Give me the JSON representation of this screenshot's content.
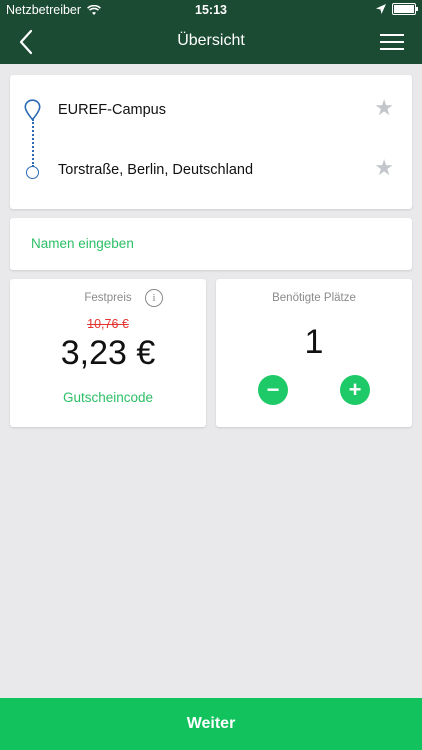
{
  "status_bar": {
    "carrier": "Netzbetreiber",
    "time": "15:13"
  },
  "nav": {
    "title": "Übersicht"
  },
  "route": {
    "from": "EUREF-Campus",
    "to": "Torstraße, Berlin, Deutschland"
  },
  "passenger": {
    "name_placeholder": "Namen eingeben"
  },
  "price": {
    "label": "Festpreis",
    "old_price": "10,76 €",
    "current_price": "3,23 €",
    "voucher_label": "Gutscheincode"
  },
  "seats": {
    "label": "Benötigte Plätze",
    "count": "1",
    "minus_symbol": "−",
    "plus_symbol": "+"
  },
  "footer": {
    "continue_label": "Weiter"
  },
  "colors": {
    "header_bg": "#1b4b33",
    "accent_green": "#12c35d",
    "strike_red": "#e3342f",
    "route_blue": "#2a6ab3"
  },
  "icons": [
    "wifi-icon",
    "location-arrow-icon",
    "battery-icon",
    "back-chevron-icon",
    "menu-icon",
    "pin-icon",
    "star-icon",
    "info-icon"
  ]
}
